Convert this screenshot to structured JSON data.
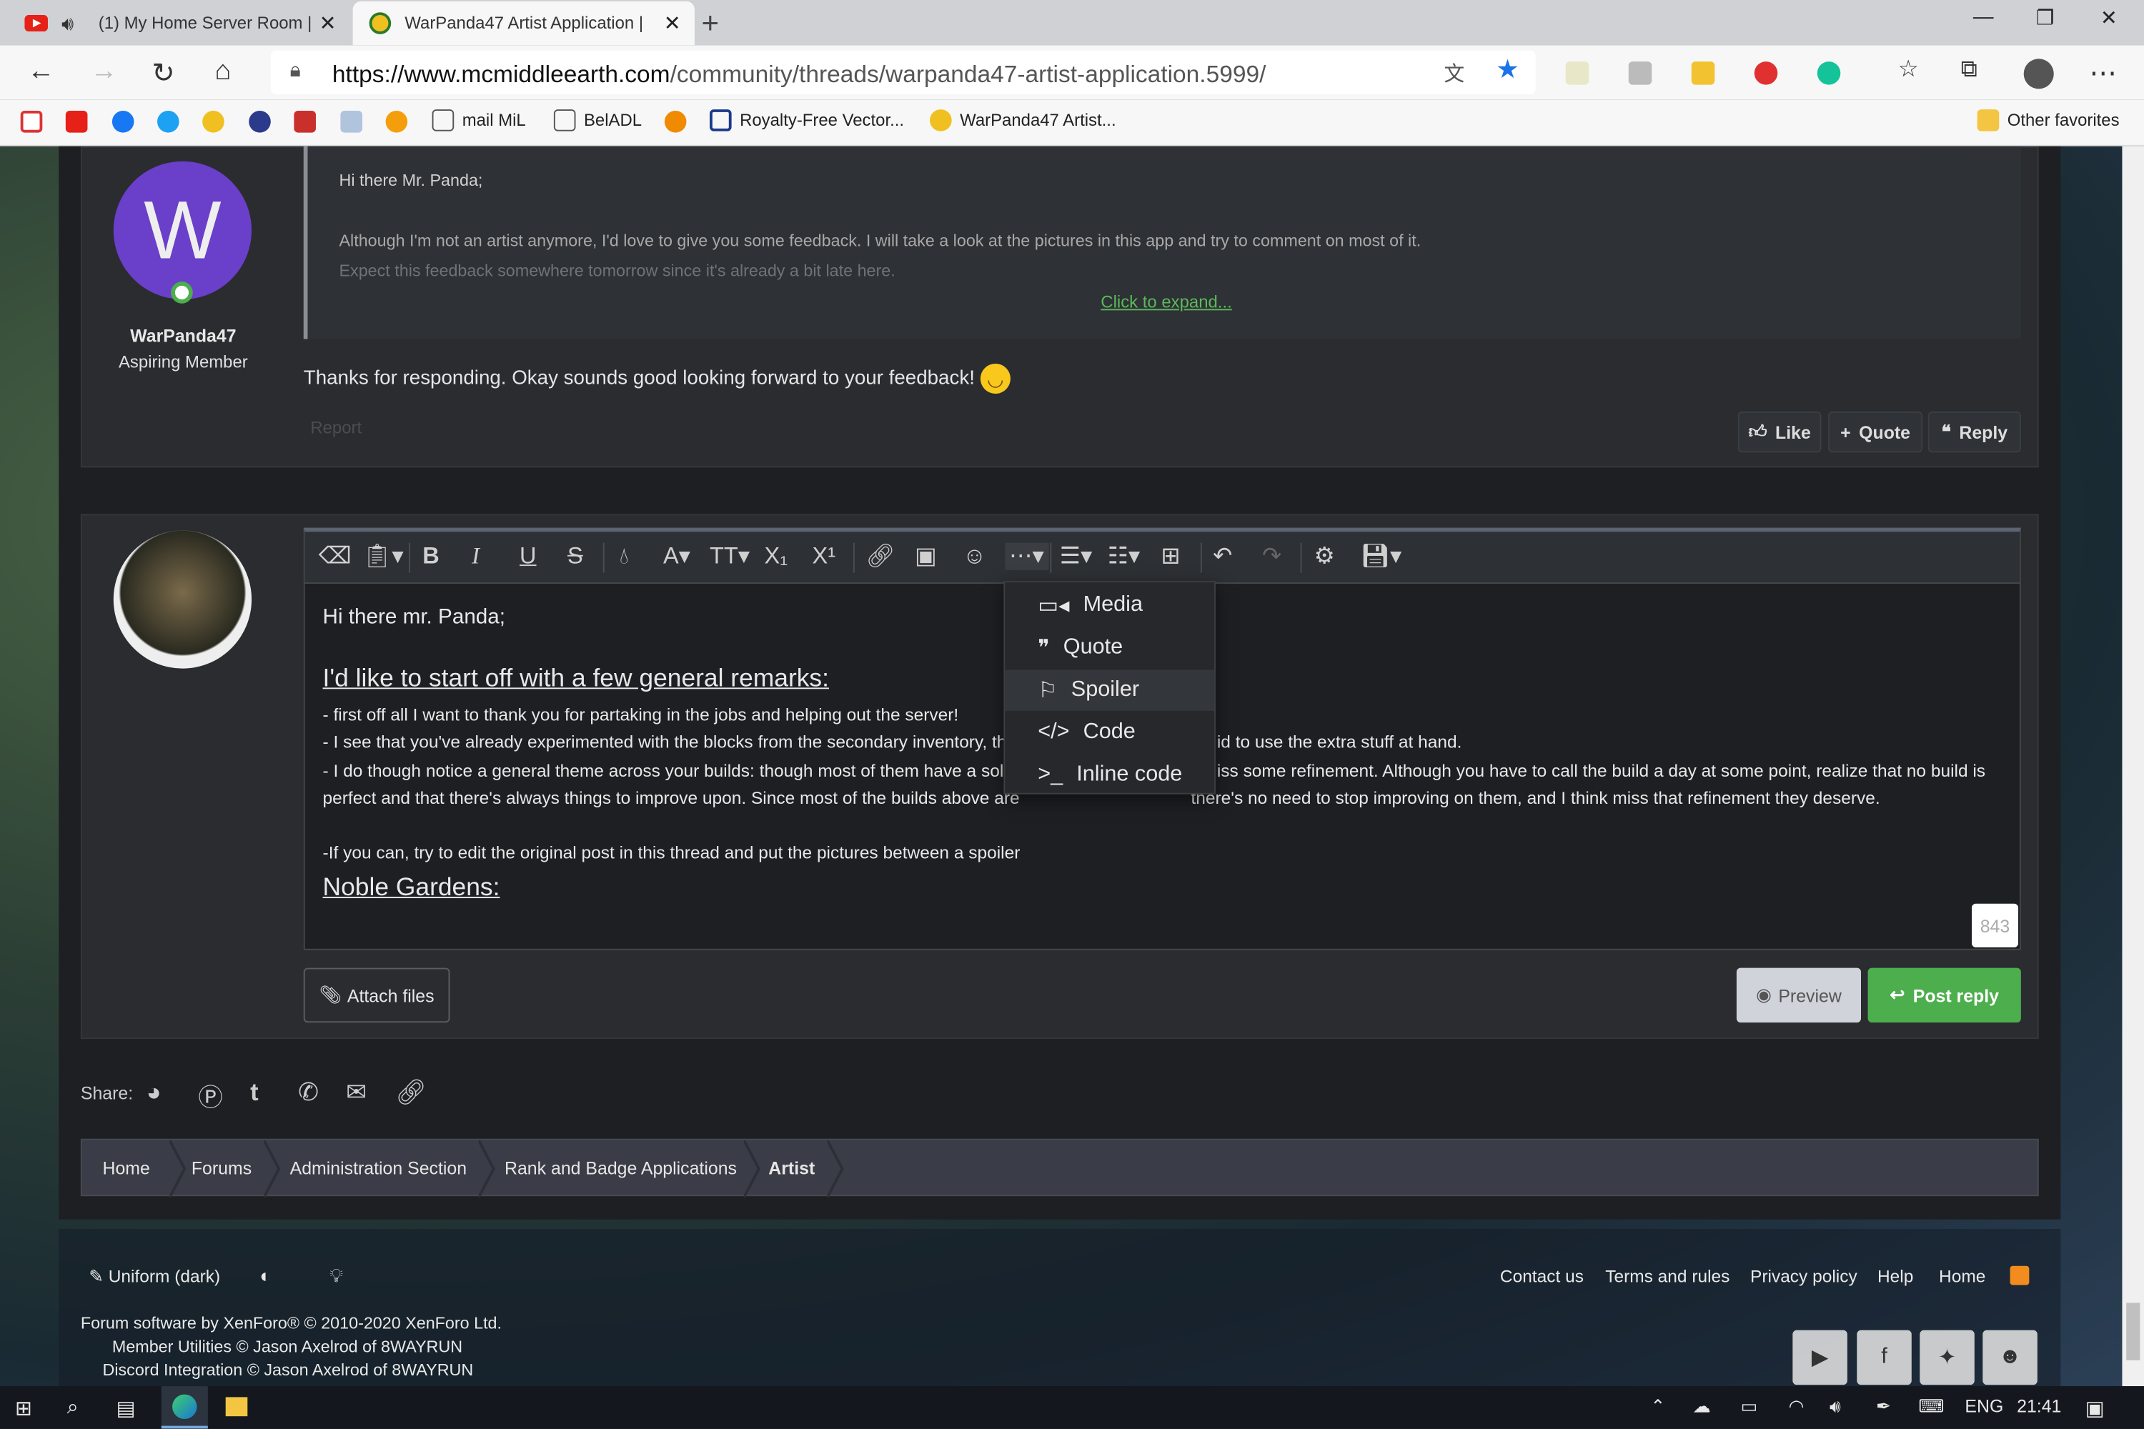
{
  "browser": {
    "tabs": [
      {
        "title": "(1) My Home Server Room |",
        "active": false
      },
      {
        "title": "WarPanda47 Artist Application |",
        "active": true
      }
    ],
    "url_host": "https://www.mcmiddleearth.com",
    "url_path": "/community/threads/warpanda47-artist-application.5999/",
    "bookmarks": [
      "mail MiL",
      "BelADL",
      "Royalty-Free Vector...",
      "WarPanda47 Artist..."
    ],
    "other_favorites": "Other favorites"
  },
  "post": {
    "avatar_letter": "W",
    "username": "WarPanda47",
    "role": "Aspiring Member",
    "quote_lines": [
      "Hi there Mr. Panda;",
      "Although I'm not an artist anymore, I'd love to give you some feedback. I will take a look at the pictures in this app and try to comment on most of it.",
      "Expect this feedback somewhere tomorrow since it's already a bit late here."
    ],
    "expand_link": "Click to expand...",
    "message": "Thanks for responding. Okay sounds good looking forward to your feedback!",
    "report": "Report",
    "actions": [
      "Like",
      "Quote",
      "Reply"
    ]
  },
  "editor": {
    "greeting": "Hi there mr. Panda;",
    "heading1": "I'd like to start off with a few general remarks:",
    "line1": "- first off all I want to thank you for partaking in the jobs and helping out the server!",
    "line2a": "- I see that you've already experimented with the blocks from the secondary inventory, th",
    "line2b": "id to use the extra stuff at hand.",
    "line3a": "- I do though notice a general theme across your builds: though most of them have a soli",
    "line3b": "iss some refinement. Although you have to call the build a day at some point, realize that no build is",
    "line4a": "perfect and that there's always things to improve upon. Since most of the builds above are",
    "line4b": "there's no need to stop improving on them, and I think miss that refinement they deserve.",
    "line5": "-If you can, try to edit the original post in this thread and put the pictures between a spoiler",
    "heading2": "Noble Gardens:",
    "char_count": "843",
    "dropdown": [
      "Media",
      "Quote",
      "Spoiler",
      "Code",
      "Inline code"
    ],
    "attach": "Attach files",
    "preview": "Preview",
    "post_reply": "Post reply"
  },
  "share_label": "Share:",
  "breadcrumbs": [
    "Home",
    "Forums",
    "Administration Section",
    "Rank and Badge Applications",
    "Artist"
  ],
  "footer": {
    "style": "Uniform (dark)",
    "links": [
      "Contact us",
      "Terms and rules",
      "Privacy policy",
      "Help",
      "Home"
    ],
    "credits": [
      "Forum software by XenForo® © 2010-2020 XenForo Ltd.",
      "Member Utilities © Jason Axelrod of 8WAYRUN",
      "Discord Integration © Jason Axelrod of 8WAYRUN"
    ]
  },
  "taskbar": {
    "lang": "ENG",
    "time": "21:41"
  },
  "colors": {
    "accent_green": "#4cae4c",
    "avatar_purple": "#6a3fc9",
    "link_green": "#5cb85c"
  }
}
